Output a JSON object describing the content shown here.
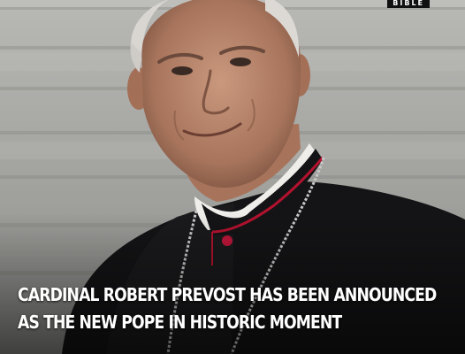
{
  "post": {
    "brand_tag": "BIBLE",
    "headline_lines": [
      "CARDINAL ROBERT PREVOST HAS BEEN ANNOUNCED",
      "AS THE NEW POPE IN HISTORIC MOMENT"
    ]
  },
  "colors": {
    "background_steps": "#a9a9a6",
    "cassock": "#141416",
    "piping": "#b3122e",
    "chain": "#c8c8c8",
    "headline_text": "#ffffff"
  },
  "photo_subject": "portrait-of-cardinal-in-black-cassock-with-red-piping-and-silver-chain"
}
